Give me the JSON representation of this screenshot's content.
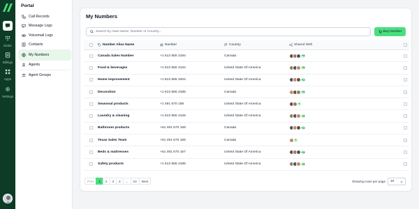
{
  "rail": {
    "items": [
      {
        "label": "",
        "icon": "chat-icon",
        "active": true
      },
      {
        "label": "Dialer",
        "icon": "dialpad-icon"
      },
      {
        "label": "Billings",
        "icon": "billing-icon"
      },
      {
        "label": "Apps",
        "icon": "apps-icon"
      },
      {
        "label": "Settings",
        "icon": "gear-icon"
      }
    ]
  },
  "sidebar": {
    "title": "Portal",
    "items": [
      {
        "label": "Call Records",
        "icon": "phone-icon"
      },
      {
        "label": "Message Logs",
        "icon": "message-icon"
      },
      {
        "label": "Voicemail Logs",
        "icon": "voicemail-icon"
      },
      {
        "label": "Contacts",
        "icon": "contacts-icon"
      },
      {
        "label": "My Numbers",
        "icon": "numbers-icon",
        "active": true
      },
      {
        "label": "Agents",
        "icon": "agent-icon"
      },
      {
        "label": "Agent Groups",
        "icon": "agent-groups-icon"
      }
    ]
  },
  "page": {
    "title": "My Numbers",
    "search_placeholder": "Search by Alias Name, Number or Country...",
    "buy_label": "Buy Number"
  },
  "table": {
    "headers": {
      "name": "Number Alias Name",
      "number": "Number",
      "country": "Country",
      "shared": "Shared With"
    },
    "rows": [
      {
        "name": "Canada Sales Number",
        "number": "+1 613 555 3184",
        "country": "Canada",
        "avatars": 3,
        "extra": "+3"
      },
      {
        "name": "Food & beverages",
        "number": "+1 813 555 3134",
        "country": "United State Of America",
        "avatars": 3,
        "extra": "+3"
      },
      {
        "name": "Home improvement",
        "number": "+1 813 555 3204",
        "country": "United State Of America",
        "avatars": 3,
        "extra": "+3"
      },
      {
        "name": "Decoration",
        "number": "+1 613 555 3185",
        "country": "Canada",
        "avatars": 3,
        "extra": "+3"
      },
      {
        "name": "Seasonal products",
        "number": "+1 491 570 158",
        "country": "United State Of America",
        "avatars": 2,
        "extra": "+"
      },
      {
        "name": "Laundry & cleaning",
        "number": "+1 813 555 3126",
        "country": "United State Of America",
        "avatars": 3,
        "extra": "+3"
      },
      {
        "name": "Bathroom products",
        "number": "+61 491 570 159",
        "country": "Canada",
        "avatars": 3,
        "extra": "+3"
      },
      {
        "name": "Texas Sales Team",
        "number": "+61 491 570 156",
        "country": "Canada",
        "avatars": 1,
        "extra": "+"
      },
      {
        "name": "Beds & mattresses",
        "number": "+61 491 570 157",
        "country": "United State Of America",
        "avatars": 3,
        "extra": "+3"
      },
      {
        "name": "Safety products",
        "number": "+1 613 555 3195",
        "country": "United State Of America",
        "avatars": 3,
        "extra": "+3"
      }
    ]
  },
  "pagination": {
    "prev": "Prev",
    "pages": [
      "1",
      "2",
      "3",
      "4",
      "...",
      "10"
    ],
    "active_page": "1",
    "next": "Next",
    "rows_label": "Showing rows per page",
    "rows_value": "10"
  },
  "colors": {
    "rail_bg": "#0d3b26",
    "accent": "#4ade80",
    "active_nav": "#e7f7ea"
  }
}
